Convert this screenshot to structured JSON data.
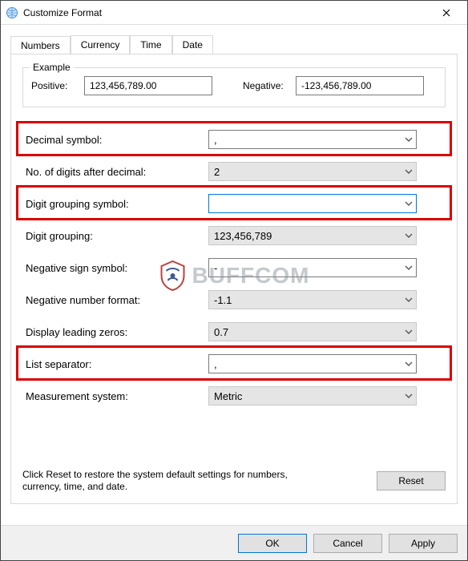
{
  "window": {
    "title": "Customize Format"
  },
  "tabs": {
    "numbers": "Numbers",
    "currency": "Currency",
    "time": "Time",
    "date": "Date"
  },
  "example": {
    "legend": "Example",
    "positive_label": "Positive:",
    "positive_value": "123,456,789.00",
    "negative_label": "Negative:",
    "negative_value": "-123,456,789.00"
  },
  "settings": {
    "decimal_symbol": {
      "label": "Decimal symbol:",
      "value": ","
    },
    "digits_after_decimal": {
      "label": "No. of digits after decimal:",
      "value": "2"
    },
    "digit_grouping_symbol": {
      "label": "Digit grouping symbol:",
      "value": ""
    },
    "digit_grouping": {
      "label": "Digit grouping:",
      "value": "123,456,789"
    },
    "negative_sign_symbol": {
      "label": "Negative sign symbol:",
      "value": "-"
    },
    "negative_number_format": {
      "label": "Negative number format:",
      "value": "-1.1"
    },
    "display_leading_zeros": {
      "label": "Display leading zeros:",
      "value": "0.7"
    },
    "list_separator": {
      "label": "List separator:",
      "value": ","
    },
    "measurement_system": {
      "label": "Measurement system:",
      "value": "Metric"
    }
  },
  "hint": "Click Reset to restore the system default settings for numbers, currency, time, and date.",
  "buttons": {
    "reset": "Reset",
    "ok": "OK",
    "cancel": "Cancel",
    "apply": "Apply"
  },
  "watermark": "BUFFCOM"
}
